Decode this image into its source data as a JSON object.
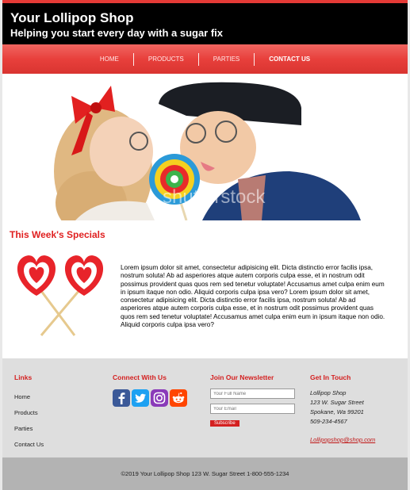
{
  "header": {
    "title": "Your Lollipop Shop",
    "tagline": "Helping you start every day with a sugar fix"
  },
  "nav": {
    "items": [
      {
        "label": "HOME"
      },
      {
        "label": "PRODUCTS"
      },
      {
        "label": "PARTIES"
      },
      {
        "label": "CONTACT US"
      }
    ]
  },
  "hero": {
    "watermark": "shutterstock"
  },
  "specials": {
    "title": "This Week's Specials",
    "body": "Lorem ipsum dolor sit amet, consectetur adipisicing elit. Dicta distinctio error facilis ipsa, nostrum soluta! Ab ad asperiores atque autem corporis culpa esse, et in nostrum odit possimus provident quas quos rem sed tenetur voluptate! Accusamus amet culpa enim eum in ipsum itaque non odio. Aliquid corporis culpa ipsa vero? Lorem ipsum dolor sit amet, consectetur adipisicing elit. Dicta distinctio error facilis ipsa, nostrum soluta! Ab ad asperiores atque autem corporis culpa esse, et in nostrum odit possimus provident quas quos rem sed tenetur voluptate! Accusamus amet culpa enim eum in ipsum itaque non odio. Aliquid corporis culpa ipsa vero?"
  },
  "footer": {
    "links": {
      "heading": "Links",
      "items": [
        "Home",
        "Products",
        "Parties",
        "Contact Us"
      ]
    },
    "connect": {
      "heading": "Connect With Us",
      "icons": [
        "facebook-icon",
        "twitter-icon",
        "instagram-icon",
        "reddit-icon"
      ]
    },
    "newsletter": {
      "heading": "Join Our Newsletter",
      "name_placeholder": "Your Full Name",
      "email_placeholder": "Your Email",
      "button": "Subscribe"
    },
    "contact": {
      "heading": "Get In Touch",
      "lines": [
        "Lollipop Shop",
        "123 W. Sugar Street",
        "Spokane, Wa 99201",
        "509-234-4567"
      ],
      "email": "Lollipopshop@shop.com"
    },
    "copyright": "©2019 Your Lollipop Shop 123 W. Sugar Street 1-800-555-1234"
  },
  "colors": {
    "accent": "#e53a36",
    "heading_red": "#d42020",
    "footer_bg": "#dedede",
    "copyright_bg": "#b3b3b3"
  }
}
